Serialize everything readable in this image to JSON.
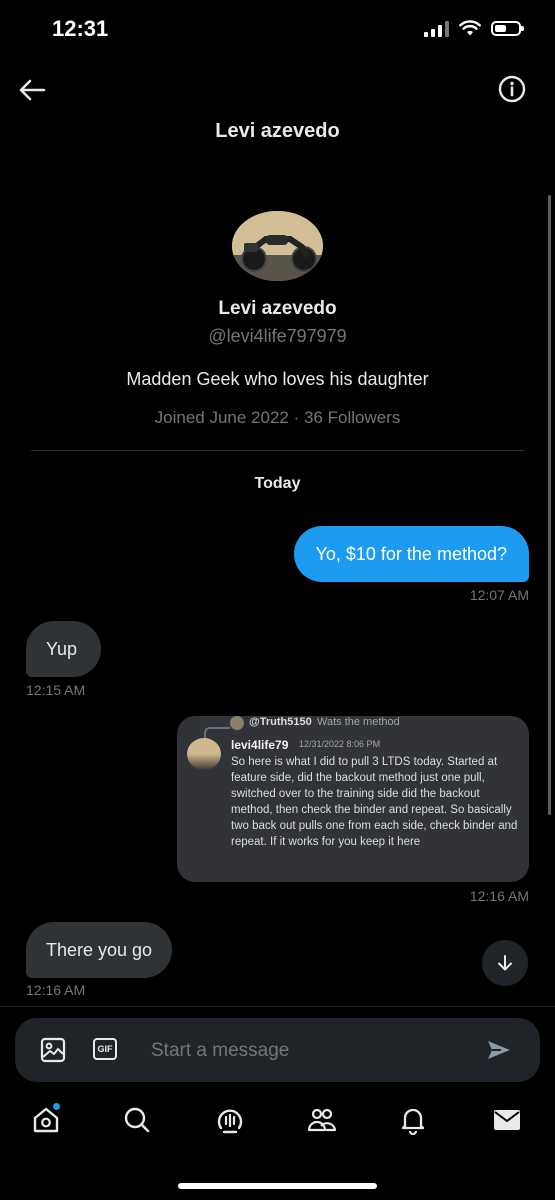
{
  "status_bar": {
    "time": "12:31"
  },
  "header": {
    "title": "Levi azevedo"
  },
  "profile": {
    "name": "Levi azevedo",
    "handle": "@levi4life797979",
    "bio": "Madden Geek who loves his daughter",
    "meta": "Joined June 2022 · 36 Followers"
  },
  "conversation": {
    "day_label": "Today",
    "messages": [
      {
        "direction": "out",
        "text": "Yo, $10 for the method?",
        "time": "12:07 AM"
      },
      {
        "direction": "in",
        "text": "Yup",
        "time": "12:15 AM"
      },
      {
        "direction": "out",
        "type": "image",
        "time": "12:16 AM",
        "image": {
          "reply_user": "@Truth5150",
          "reply_text": "Wats the method",
          "author": "levi4life79",
          "date": "12/31/2022 8:06 PM",
          "body": "So here is what I did to pull 3 LTDS today. Started at feature side, did the backout method just one pull, switched over to the training side did the backout method, then check the binder and repeat. So basically two back out pulls one from each side, check binder and repeat. If it works for you keep it here"
        }
      },
      {
        "direction": "in",
        "text": "There you go",
        "time": "12:16 AM"
      }
    ]
  },
  "composer": {
    "placeholder": "Start a message"
  },
  "tabs": [
    "home-icon",
    "search-icon",
    "spaces-icon",
    "communities-icon",
    "notifications-icon",
    "messages-icon"
  ],
  "colors": {
    "accent": "#1d9bf0",
    "background": "#000000",
    "bubble_in": "#2f3336",
    "muted": "#71767b"
  }
}
